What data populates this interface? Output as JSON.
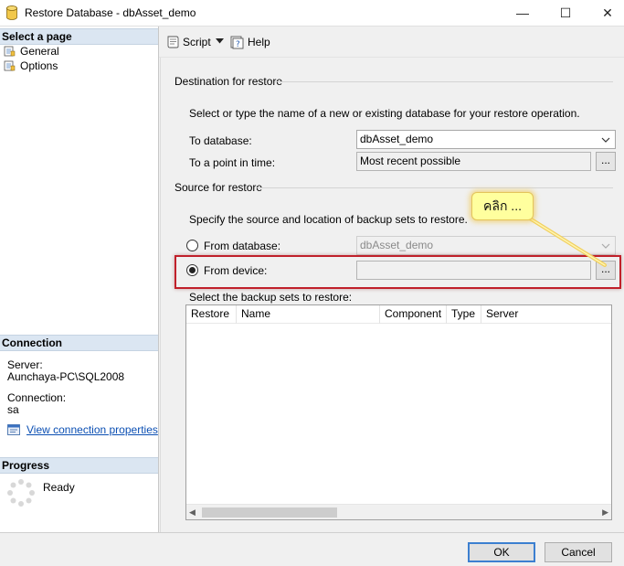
{
  "window": {
    "title": "Restore Database - dbAsset_demo",
    "minimize_glyph": "—",
    "maximize_glyph": "☐",
    "close_glyph": "✕",
    "icon": "database-icon"
  },
  "left_pane": {
    "select_page_header": "Select a page",
    "pages": [
      {
        "label": "General",
        "icon": "page-icon"
      },
      {
        "label": "Options",
        "icon": "page-icon"
      }
    ],
    "connection_header": "Connection",
    "server_label": "Server:",
    "server_value": "Aunchaya-PC\\SQL2008",
    "connection_label": "Connection:",
    "connection_value": "sa",
    "view_connection_link": "View connection properties",
    "progress_header": "Progress",
    "progress_status": "Ready"
  },
  "toolbar": {
    "script_label": "Script",
    "help_label": "Help"
  },
  "destination": {
    "group_title": "Destination for restore",
    "description": "Select or type the name of a new or existing database for your restore operation.",
    "to_database_label": "To database:",
    "to_database_value": "dbAsset_demo",
    "point_in_time_label": "To a point in time:",
    "point_in_time_value": "Most recent possible",
    "ellipsis": "..."
  },
  "source": {
    "group_title": "Source for restore",
    "description": "Specify the source and location of backup sets to restore.",
    "from_database_label": "From database:",
    "from_database_value": "dbAsset_demo",
    "from_device_label": "From device:",
    "from_device_value": "",
    "ellipsis": "...",
    "selected_option": "From device"
  },
  "callout": {
    "text": "คลิก ..."
  },
  "backup_sets": {
    "label": "Select the backup sets to restore:",
    "columns": [
      "Restore",
      "Name",
      "Component",
      "Type",
      "Server"
    ]
  },
  "buttons": {
    "ok": "OK",
    "cancel": "Cancel"
  },
  "colors": {
    "highlight_border": "#c0202a",
    "callout_bg": "#ffff9e",
    "section_header_bg": "#dbe6f2",
    "link": "#0b4fb3",
    "default_button_border": "#3c7fd0"
  }
}
